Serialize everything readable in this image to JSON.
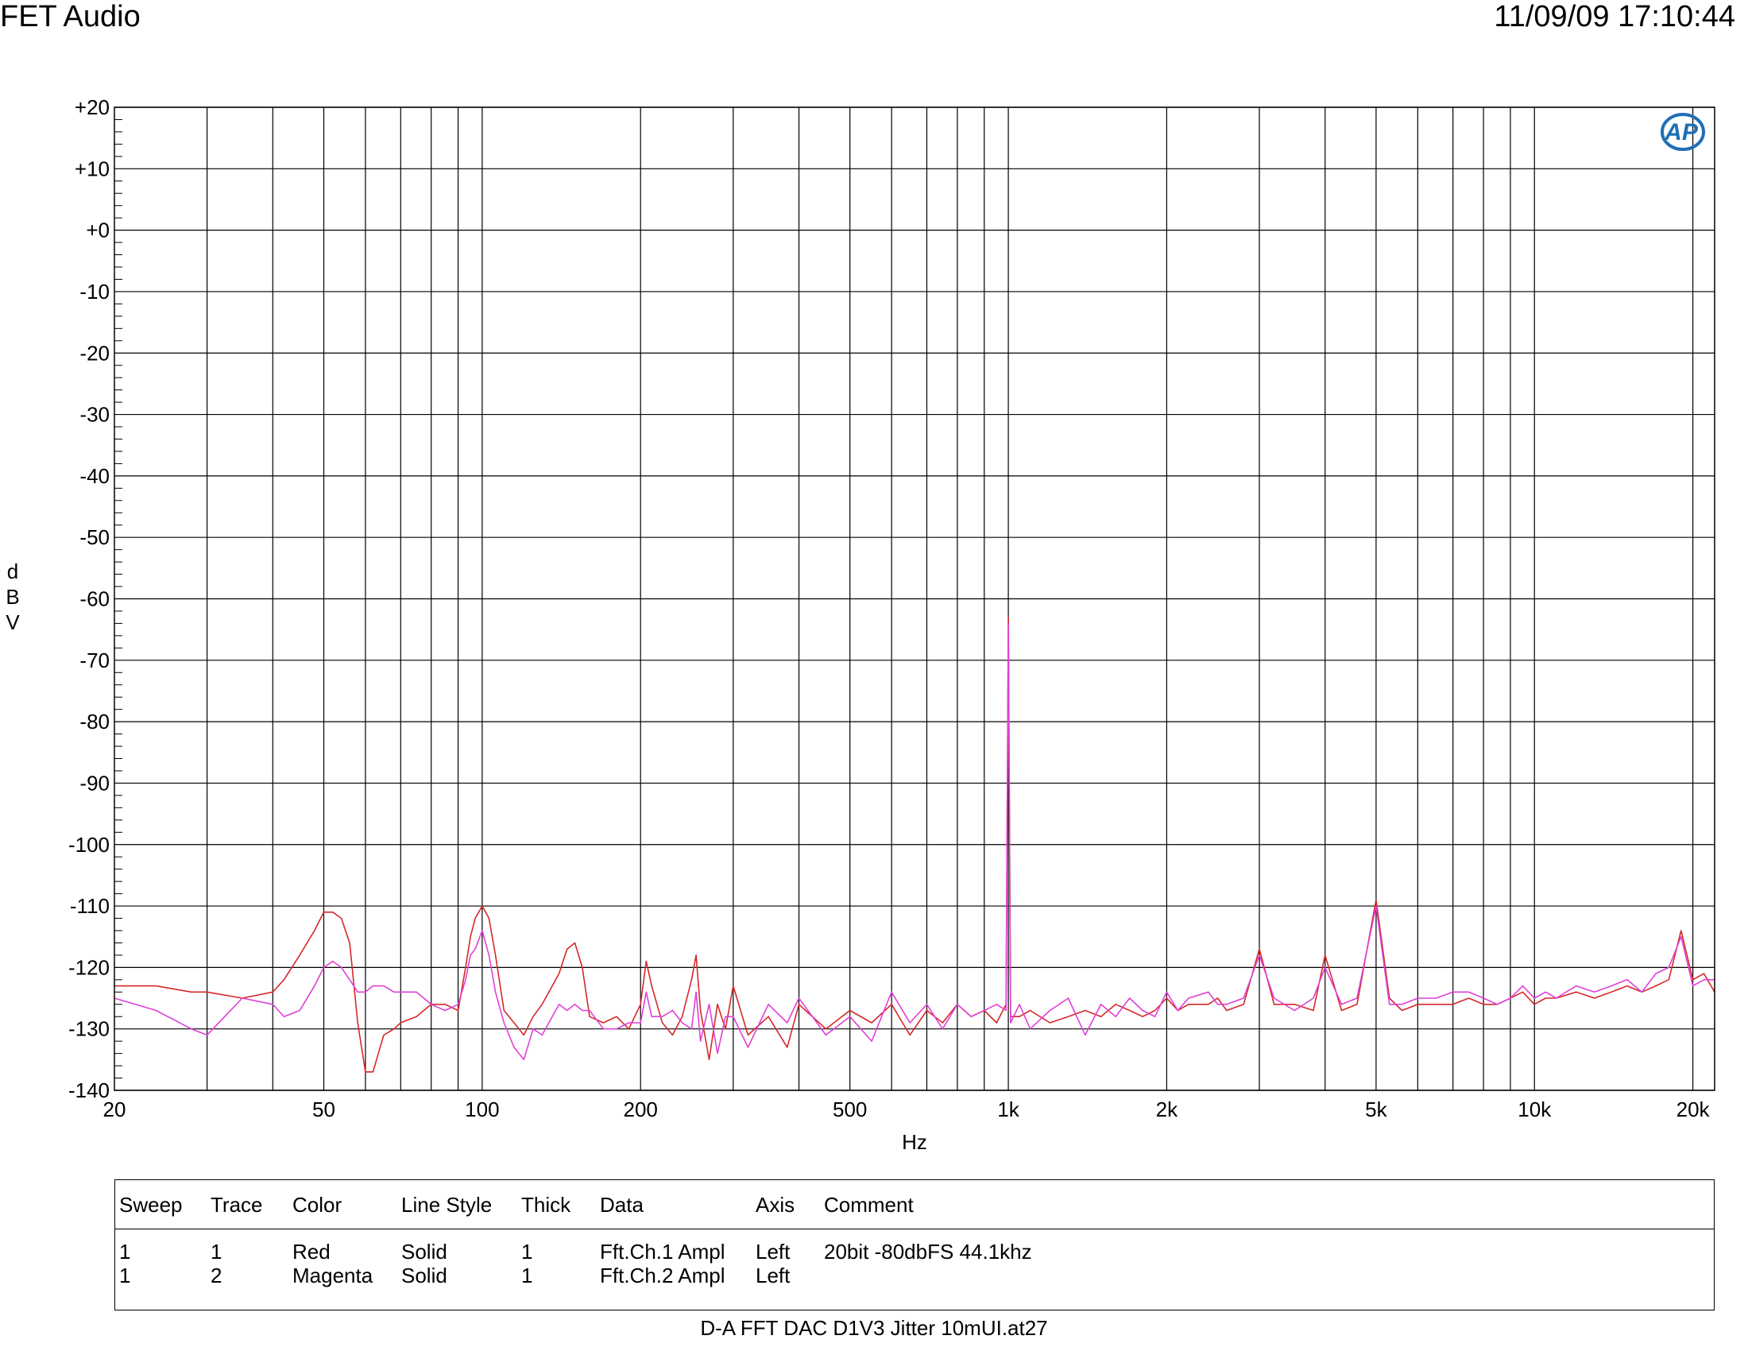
{
  "header": {
    "company": "FET Audio",
    "timestamp": "11/09/09 17:10:44"
  },
  "footer": {
    "filename": "D-A FFT DAC D1V3 Jitter 10mUI.at27"
  },
  "colors": {
    "trace_red": "#d62828",
    "trace_magenta": "#e040d8",
    "logo": "#1f6fb5",
    "grid": "#000000"
  },
  "logo": {
    "text": "AP",
    "icon": "ap-logo-icon"
  },
  "chart_data": {
    "type": "line",
    "title": "",
    "xlabel": "Hz",
    "ylabel": "dBV",
    "xscale": "log",
    "xlim": [
      20,
      22000
    ],
    "ylim": [
      -140,
      20
    ],
    "grid": true,
    "x_tick_values": [
      20,
      50,
      100,
      200,
      500,
      1000,
      2000,
      5000,
      10000,
      20000
    ],
    "x_tick_labels": [
      "20",
      "50",
      "100",
      "200",
      "500",
      "1k",
      "2k",
      "5k",
      "10k",
      "20k"
    ],
    "y_tick_values": [
      20,
      10,
      0,
      -10,
      -20,
      -30,
      -40,
      -50,
      -60,
      -70,
      -80,
      -90,
      -100,
      -110,
      -120,
      -130,
      -140
    ],
    "y_tick_labels": [
      "+20",
      "+10",
      "+0",
      "-10",
      "-20",
      "-30",
      "-40",
      "-50",
      "-60",
      "-70",
      "-80",
      "-90",
      "-100",
      "-110",
      "-120",
      "-130",
      "-140"
    ],
    "series": [
      {
        "name": "Fft.Ch.1 Ampl",
        "color": "Red",
        "x": [
          20,
          24,
          28,
          30,
          35,
          40,
          42,
          45,
          48,
          50,
          52,
          54,
          56,
          58,
          60,
          62,
          65,
          68,
          70,
          75,
          80,
          85,
          90,
          93,
          95,
          97,
          100,
          103,
          106,
          110,
          115,
          120,
          125,
          130,
          140,
          145,
          150,
          155,
          160,
          170,
          180,
          190,
          200,
          205,
          210,
          220,
          230,
          240,
          250,
          255,
          260,
          270,
          280,
          290,
          300,
          320,
          350,
          380,
          400,
          450,
          500,
          550,
          600,
          650,
          700,
          750,
          800,
          850,
          900,
          950,
          990,
          1000,
          1010,
          1050,
          1100,
          1200,
          1300,
          1400,
          1500,
          1600,
          1700,
          1800,
          1900,
          2000,
          2100,
          2200,
          2400,
          2500,
          2600,
          2800,
          3000,
          3200,
          3500,
          3800,
          4000,
          4300,
          4600,
          5000,
          5300,
          5600,
          6000,
          6500,
          7000,
          7500,
          8000,
          8500,
          9000,
          9500,
          10000,
          10500,
          11000,
          12000,
          13000,
          14000,
          15000,
          16000,
          17000,
          18000,
          19000,
          20000,
          21000,
          22000
        ],
        "y": [
          -123,
          -123,
          -124,
          -124,
          -125,
          -124,
          -122,
          -118,
          -114,
          -111,
          -111,
          -112,
          -116,
          -129,
          -137,
          -137,
          -131,
          -130,
          -129,
          -128,
          -126,
          -126,
          -127,
          -120,
          -115,
          -112,
          -110,
          -112,
          -118,
          -127,
          -129,
          -131,
          -128,
          -126,
          -121,
          -117,
          -116,
          -120,
          -128,
          -129,
          -128,
          -130,
          -126,
          -119,
          -123,
          -129,
          -131,
          -128,
          -122,
          -118,
          -127,
          -135,
          -126,
          -130,
          -123,
          -131,
          -128,
          -133,
          -126,
          -130,
          -127,
          -129,
          -126,
          -131,
          -127,
          -129,
          -126,
          -128,
          -127,
          -129,
          -126,
          -63,
          -128,
          -128,
          -127,
          -129,
          -128,
          -127,
          -128,
          -126,
          -127,
          -128,
          -127,
          -125,
          -127,
          -126,
          -126,
          -125,
          -127,
          -126,
          -117,
          -126,
          -126,
          -127,
          -118,
          -127,
          -126,
          -109,
          -125,
          -127,
          -126,
          -126,
          -126,
          -125,
          -126,
          -126,
          -125,
          -124,
          -126,
          -125,
          -125,
          -124,
          -125,
          -124,
          -123,
          -124,
          -123,
          -122,
          -114,
          -122,
          -121,
          -124
        ]
      },
      {
        "name": "Fft.Ch.2 Ampl",
        "color": "Magenta",
        "x": [
          20,
          24,
          28,
          30,
          35,
          40,
          42,
          45,
          48,
          50,
          52,
          54,
          56,
          58,
          60,
          62,
          65,
          68,
          70,
          75,
          80,
          85,
          90,
          93,
          95,
          97,
          100,
          103,
          106,
          110,
          115,
          120,
          125,
          130,
          140,
          145,
          150,
          155,
          160,
          170,
          180,
          190,
          200,
          205,
          210,
          220,
          230,
          240,
          250,
          255,
          260,
          270,
          280,
          290,
          300,
          320,
          350,
          380,
          400,
          450,
          500,
          550,
          600,
          650,
          700,
          750,
          800,
          850,
          900,
          950,
          990,
          1000,
          1010,
          1050,
          1100,
          1200,
          1300,
          1400,
          1500,
          1600,
          1700,
          1800,
          1900,
          2000,
          2100,
          2200,
          2400,
          2500,
          2600,
          2800,
          3000,
          3200,
          3500,
          3800,
          4000,
          4300,
          4600,
          5000,
          5300,
          5600,
          6000,
          6500,
          7000,
          7500,
          8000,
          8500,
          9000,
          9500,
          10000,
          10500,
          11000,
          12000,
          13000,
          14000,
          15000,
          16000,
          17000,
          18000,
          19000,
          20000,
          21000,
          22000
        ],
        "y": [
          -125,
          -127,
          -130,
          -131,
          -125,
          -126,
          -128,
          -127,
          -123,
          -120,
          -119,
          -120,
          -122,
          -124,
          -124,
          -123,
          -123,
          -124,
          -124,
          -124,
          -126,
          -127,
          -126,
          -122,
          -118,
          -117,
          -114,
          -118,
          -124,
          -129,
          -133,
          -135,
          -130,
          -131,
          -126,
          -127,
          -126,
          -127,
          -127,
          -130,
          -130,
          -129,
          -129,
          -124,
          -128,
          -128,
          -127,
          -129,
          -130,
          -124,
          -132,
          -126,
          -134,
          -128,
          -128,
          -133,
          -126,
          -129,
          -125,
          -131,
          -128,
          -132,
          -124,
          -129,
          -126,
          -130,
          -126,
          -128,
          -127,
          -126,
          -127,
          -64,
          -129,
          -126,
          -130,
          -127,
          -125,
          -131,
          -126,
          -128,
          -125,
          -127,
          -128,
          -124,
          -127,
          -125,
          -124,
          -126,
          -126,
          -125,
          -118,
          -125,
          -127,
          -125,
          -120,
          -126,
          -125,
          -110,
          -126,
          -126,
          -125,
          -125,
          -124,
          -124,
          -125,
          -126,
          -125,
          -123,
          -125,
          -124,
          -125,
          -123,
          -124,
          -123,
          -122,
          -124,
          -121,
          -120,
          -115,
          -123,
          -122,
          -122
        ]
      }
    ]
  },
  "legend": {
    "headers": [
      "Sweep",
      "Trace",
      "Color",
      "Line Style",
      "Thick",
      "Data",
      "Axis",
      "Comment"
    ],
    "rows": [
      [
        "1",
        "1",
        "Red",
        "Solid",
        "1",
        "Fft.Ch.1 Ampl",
        "Left",
        "20bit -80dbFS 44.1khz"
      ],
      [
        "1",
        "2",
        "Magenta",
        "Solid",
        "1",
        "Fft.Ch.2 Ampl",
        "Left",
        ""
      ]
    ]
  }
}
